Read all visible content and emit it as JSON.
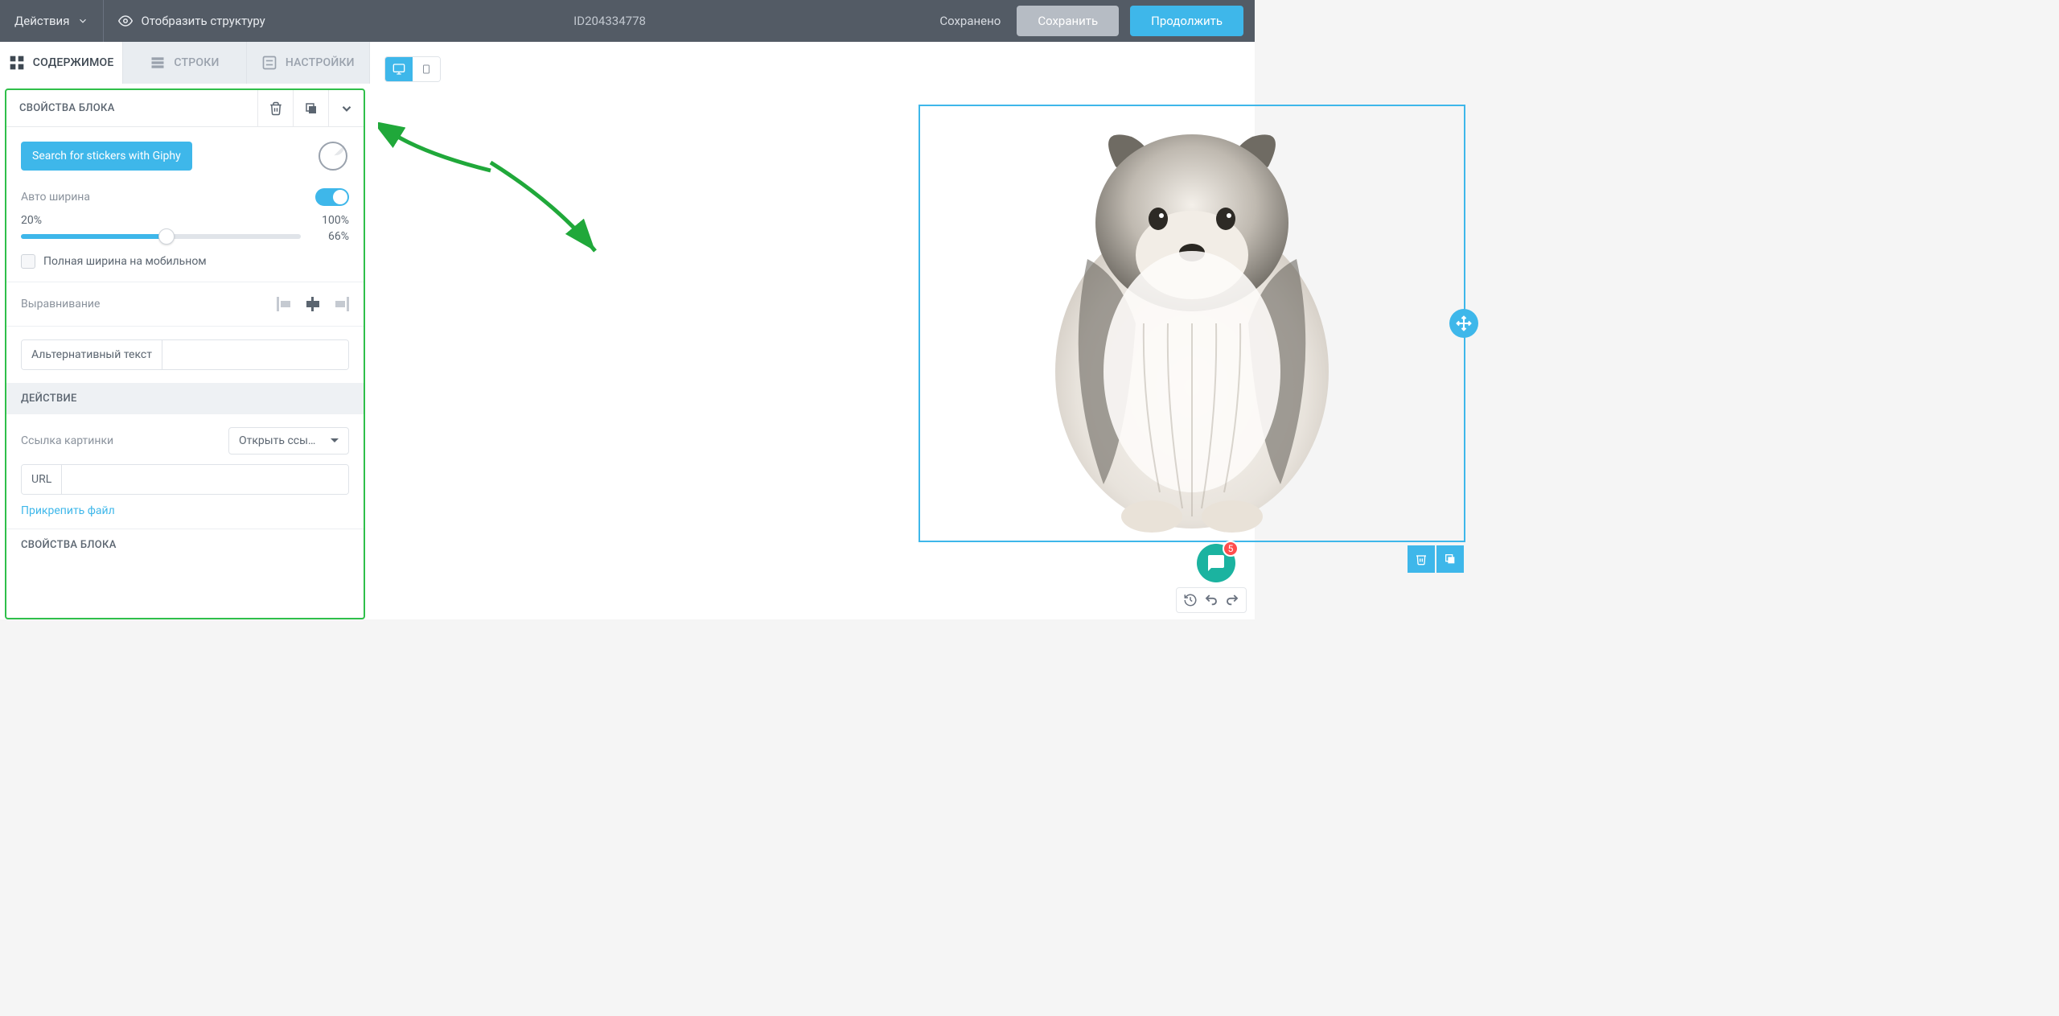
{
  "topbar": {
    "actions_label": "Действия",
    "show_structure_label": "Отобразить структуру",
    "doc_id": "ID204334778",
    "status": "Сохранено",
    "save_label": "Сохранить",
    "continue_label": "Продолжить"
  },
  "tabs": {
    "content": "СОДЕРЖИМОЕ",
    "rows": "СТРОКИ",
    "settings": "НАСТРОЙКИ"
  },
  "panel": {
    "header_title": "СВОЙСТВА БЛОКА",
    "giphy_button": "Search for stickers with Giphy",
    "auto_width_label": "Авто ширина",
    "slider_min_label": "20%",
    "slider_max_label": "100%",
    "slider_value": "66%",
    "full_width_mobile_label": "Полная ширина на мобильном",
    "alignment_label": "Выравнивание",
    "alt_text_label": "Альтернативный текст",
    "action_section": "ДЕЙСТВИЕ",
    "image_link_label": "Ссылка картинки",
    "link_select_value": "Открыть ссы…",
    "url_label": "URL",
    "attach_file": "Прикрепить файл",
    "footer_title": "СВОЙСТВА БЛОКА"
  },
  "fab": {
    "badge": "5"
  }
}
